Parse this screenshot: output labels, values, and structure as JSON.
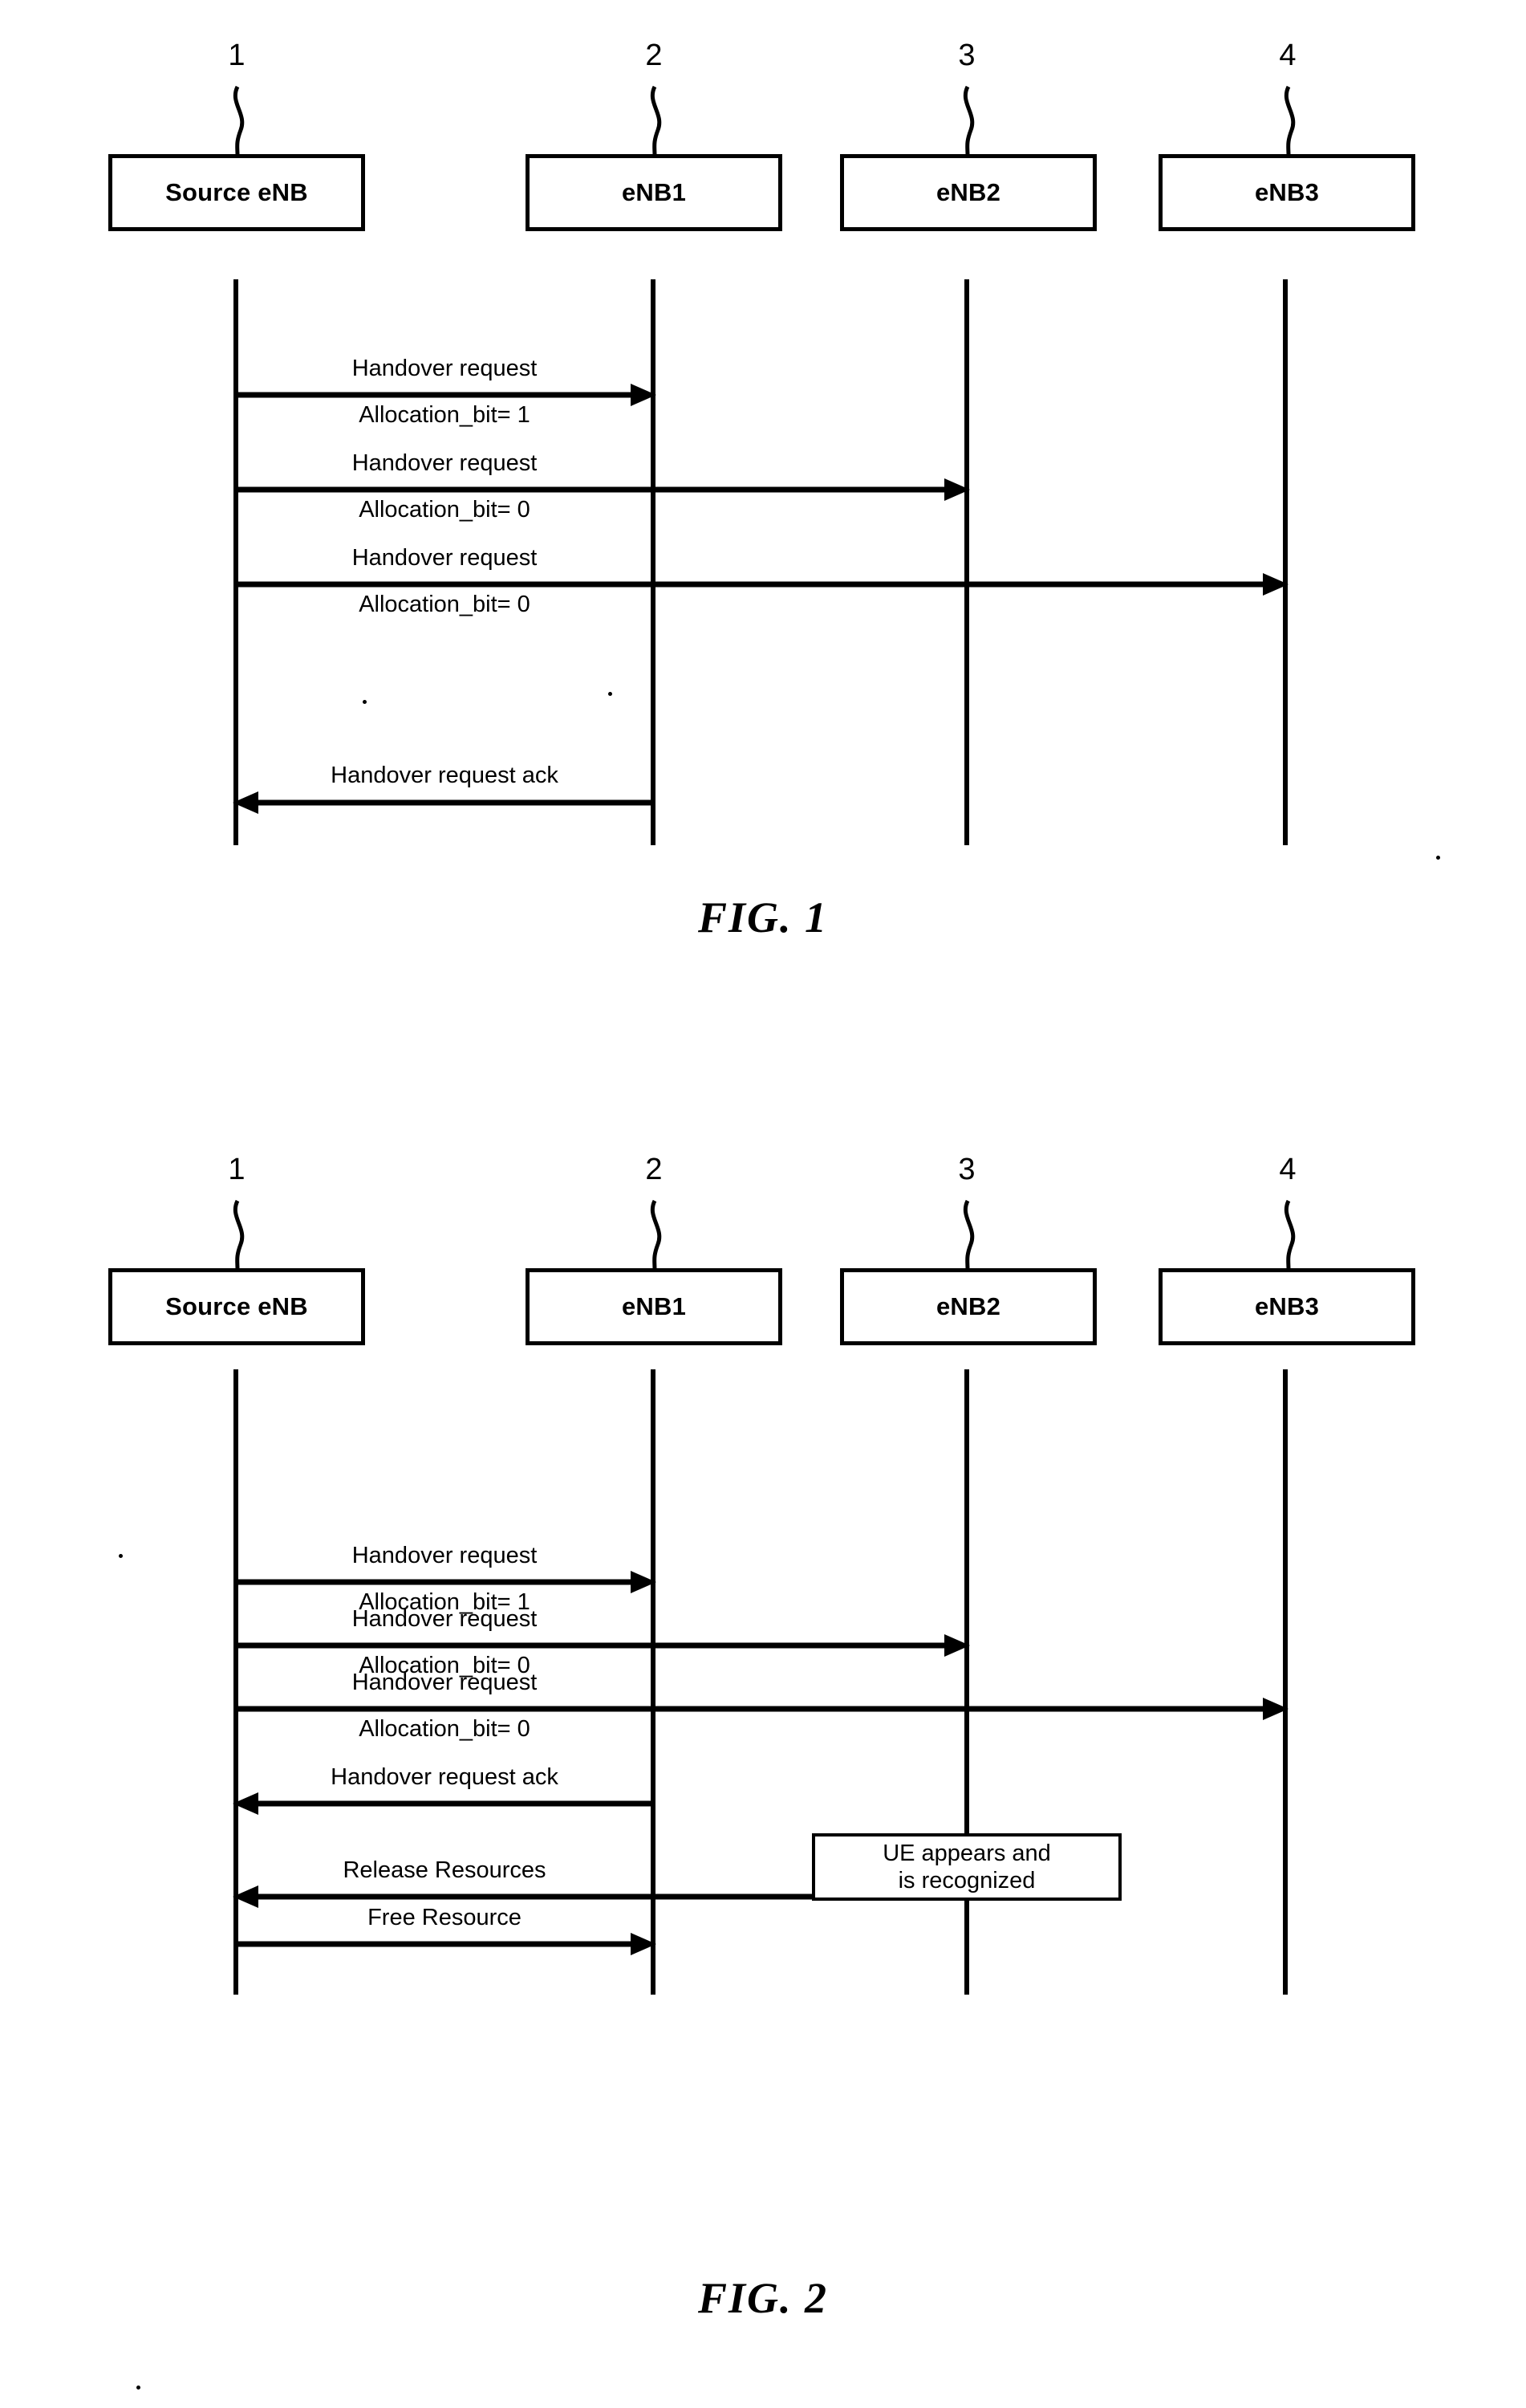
{
  "document": {
    "type": "patent-drawing-sheet",
    "figures": [
      {
        "id": "figure-1",
        "caption": "FIG.   1",
        "lifelines": [
          {
            "ref": "1",
            "label": "Source eNB"
          },
          {
            "ref": "2",
            "label": "eNB1"
          },
          {
            "ref": "3",
            "label": "eNB2"
          },
          {
            "ref": "4",
            "label": "eNB3"
          }
        ],
        "messages": [
          {
            "title": "Handover request",
            "sub": "Allocation_bit= 1",
            "from": 0,
            "to": 1,
            "direction": "right"
          },
          {
            "title": "Handover request",
            "sub": "Allocation_bit= 0",
            "from": 0,
            "to": 2,
            "direction": "right"
          },
          {
            "title": "Handover request",
            "sub": "Allocation_bit= 0",
            "from": 0,
            "to": 3,
            "direction": "right"
          },
          {
            "title": "Handover request ack",
            "sub": "",
            "from": 1,
            "to": 0,
            "direction": "left"
          }
        ]
      },
      {
        "id": "figure-2",
        "caption": "FIG.   2",
        "lifelines": [
          {
            "ref": "1",
            "label": "Source eNB"
          },
          {
            "ref": "2",
            "label": "eNB1"
          },
          {
            "ref": "3",
            "label": "eNB2"
          },
          {
            "ref": "4",
            "label": "eNB3"
          }
        ],
        "messages": [
          {
            "title": "Handover request",
            "sub": "Allocation_bit= 1",
            "from": 0,
            "to": 1,
            "direction": "right"
          },
          {
            "title": "Handover request",
            "sub": "Allocation_bit= 0",
            "from": 0,
            "to": 2,
            "direction": "right"
          },
          {
            "title": "Handover request",
            "sub": "Allocation_bit= 0",
            "from": 0,
            "to": 3,
            "direction": "right"
          },
          {
            "title": "Handover request ack",
            "sub": "",
            "from": 1,
            "to": 0,
            "direction": "left"
          },
          {
            "title": "Release Resources",
            "sub": "",
            "from": 2,
            "to": 0,
            "direction": "left"
          },
          {
            "title": "Free Resource",
            "sub": "",
            "from": 0,
            "to": 1,
            "direction": "right"
          }
        ],
        "note": {
          "lines": [
            "UE appears and",
            "is recognized"
          ],
          "attached_to": 2
        }
      }
    ]
  },
  "fig1": {
    "caption": "FIG.   1",
    "nodes": {
      "n0": {
        "label": "Source eNB",
        "ref": "1"
      },
      "n1": {
        "label": "eNB1",
        "ref": "2"
      },
      "n2": {
        "label": "eNB2",
        "ref": "3"
      },
      "n3": {
        "label": "eNB3",
        "ref": "4"
      }
    },
    "m0": {
      "title": "Handover request",
      "sub": "Allocation_bit= 1"
    },
    "m1": {
      "title": "Handover request",
      "sub": "Allocation_bit= 0"
    },
    "m2": {
      "title": "Handover request",
      "sub": "Allocation_bit= 0"
    },
    "m3": {
      "title": "Handover request ack"
    }
  },
  "fig2": {
    "caption": "FIG.   2",
    "nodes": {
      "n0": {
        "label": "Source eNB",
        "ref": "1"
      },
      "n1": {
        "label": "eNB1",
        "ref": "2"
      },
      "n2": {
        "label": "eNB2",
        "ref": "3"
      },
      "n3": {
        "label": "eNB3",
        "ref": "4"
      }
    },
    "m0": {
      "title": "Handover request",
      "sub": "Allocation_bit= 1"
    },
    "m1": {
      "title": "Handover request",
      "sub": "Allocation_bit= 0"
    },
    "m2": {
      "title": "Handover request",
      "sub": "Allocation_bit= 0"
    },
    "m3": {
      "title": "Handover request ack"
    },
    "m4": {
      "title": "Release Resources"
    },
    "m5": {
      "title": "Free Resource"
    },
    "note": {
      "line1": "UE appears and",
      "line2": "is recognized"
    }
  },
  "colors": {
    "ink": "#000000",
    "paper": "#ffffff"
  }
}
